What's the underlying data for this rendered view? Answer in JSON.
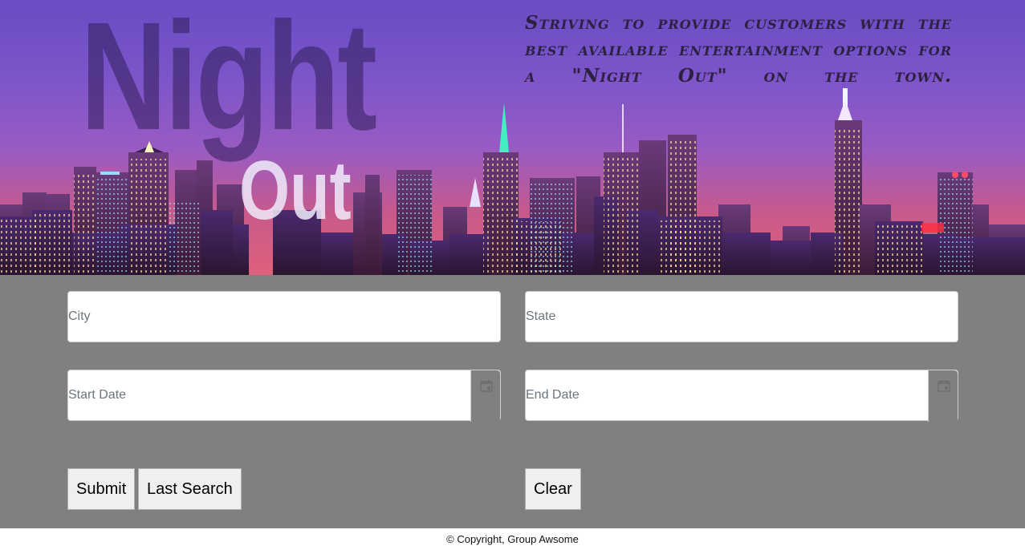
{
  "header": {
    "title_line1": "Night",
    "title_line2": "Out",
    "tagline": "Striving to provide customers with the best available entertainment options for a \"Night Out\" on the town."
  },
  "form": {
    "city": {
      "placeholder": "City",
      "value": ""
    },
    "state": {
      "placeholder": "State",
      "value": ""
    },
    "start_date": {
      "placeholder": "Start Date",
      "value": "",
      "icon": "calendar-icon"
    },
    "end_date": {
      "placeholder": "End Date",
      "value": "",
      "icon": "calendar-icon"
    }
  },
  "buttons": {
    "submit": "Submit",
    "last_search": "Last Search",
    "clear": "Clear"
  },
  "footer": {
    "copyright": "© Copyright, Group Awsome"
  }
}
